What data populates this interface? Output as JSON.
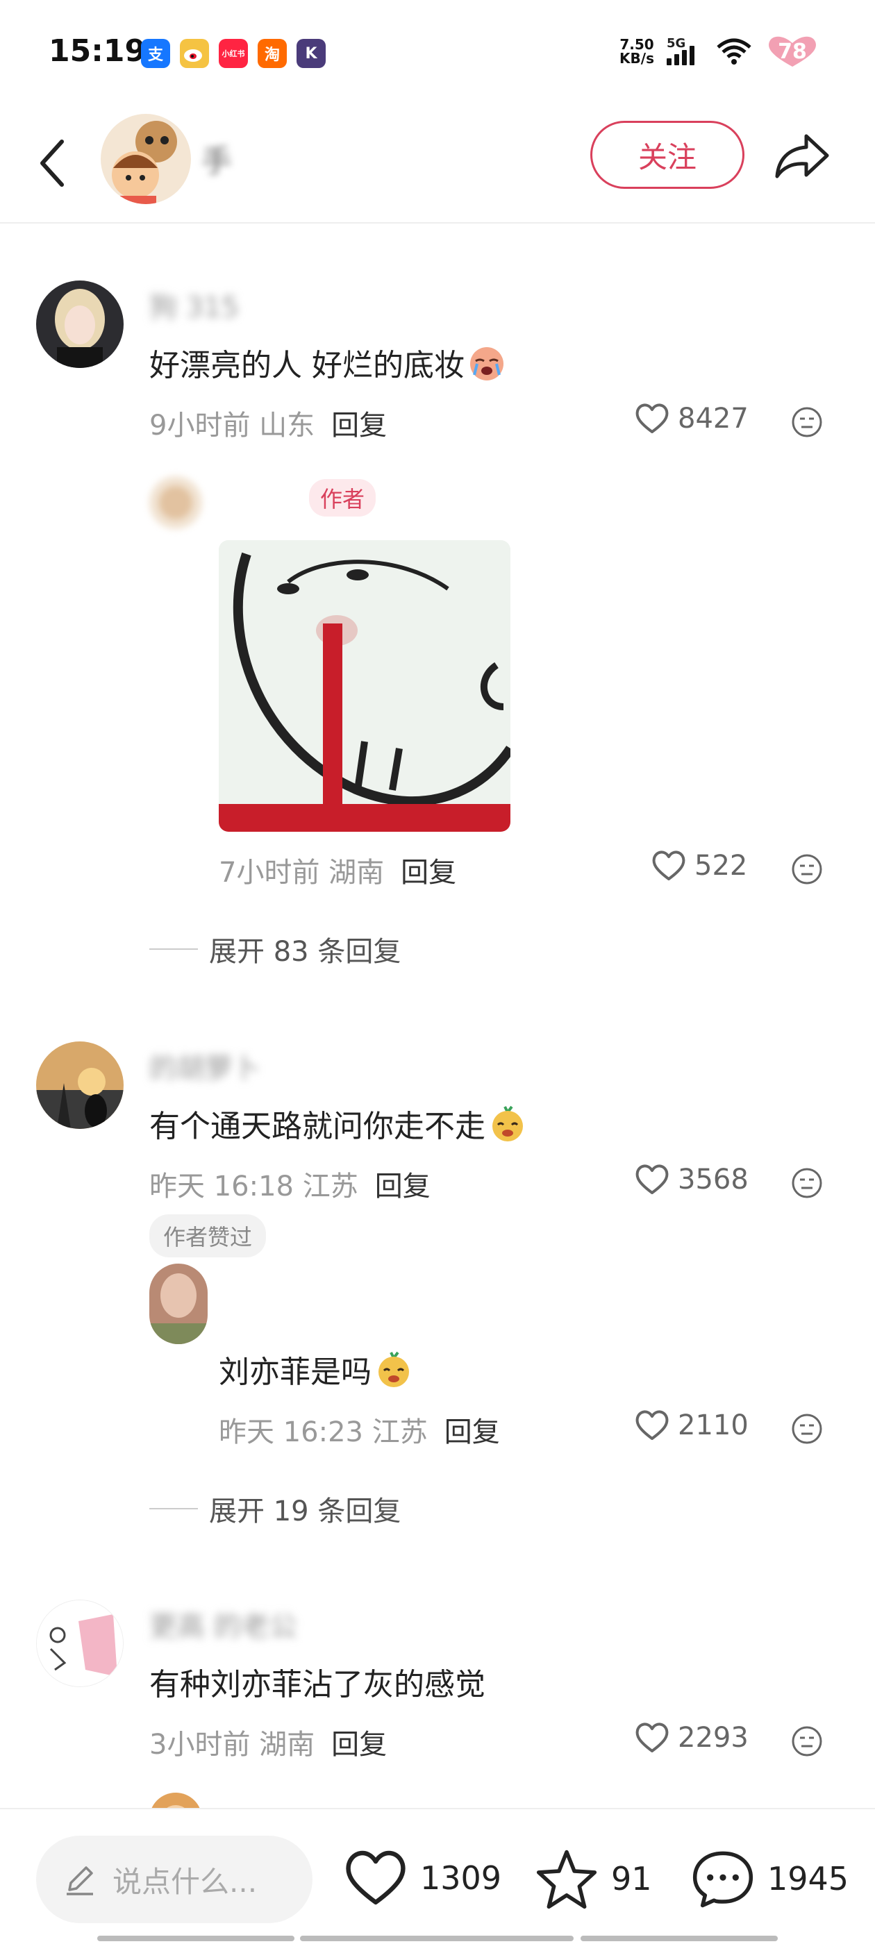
{
  "status_bar": {
    "time": "15:19",
    "apps": [
      {
        "icon": "alipay-icon",
        "glyph": "支",
        "color": "#1677ff"
      },
      {
        "icon": "weibo-icon",
        "glyph": "",
        "color": "#f5a623"
      },
      {
        "icon": "xiaohongshu-icon",
        "glyph": "小红书",
        "color": "#ff2442"
      },
      {
        "icon": "taobao-icon",
        "glyph": "淘",
        "color": "#ff6a00"
      },
      {
        "icon": "kuaishou-icon",
        "glyph": "K",
        "color": "#4a3b7a"
      }
    ],
    "net_speed_value": "7.50",
    "net_speed_unit": "KB/s",
    "network": "5G",
    "battery": "78"
  },
  "header": {
    "username": "手",
    "follow_label": "关注"
  },
  "comments": [
    {
      "username": "狗 315",
      "text": "好漂亮的人 好烂的底妆",
      "time_location": "9小时前 山东",
      "reply_label": "回复",
      "likes": "8427",
      "reply": {
        "author_tag": "作者",
        "time_location": "7小时前 湖南",
        "reply_label": "回复",
        "likes": "522"
      },
      "expand_label": "展开 83 条回复"
    },
    {
      "username": "的胡萝卜",
      "text": "有个通天路就问你走不走",
      "time_location": "昨天 16:18 江苏",
      "reply_label": "回复",
      "likes": "3568",
      "liked_by_author": "作者赞过",
      "reply": {
        "username": "",
        "text": "刘亦菲是吗",
        "time_location": "昨天 16:23 江苏",
        "reply_label": "回复",
        "likes": "2110"
      },
      "expand_label": "展开 19 条回复"
    },
    {
      "username": "更高 的老公",
      "text": "有种刘亦菲沾了灰的感觉",
      "time_location": "3小时前 湖南",
      "reply_label": "回复",
      "likes": "2293"
    }
  ],
  "bottom_bar": {
    "input_placeholder": "说点什么...",
    "likes": "1309",
    "favorites": "91",
    "comments": "1945"
  }
}
